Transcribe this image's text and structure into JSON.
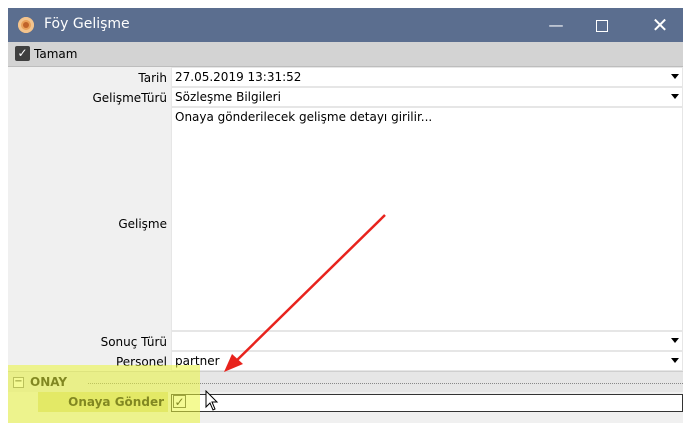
{
  "window": {
    "title": "Föy Gelişme",
    "controls": {
      "minimize_icon": "minimize-icon",
      "maximize_icon": "maximize-icon",
      "close_icon": "close-icon"
    }
  },
  "toolbar": {
    "ok_label": "Tamam"
  },
  "form": {
    "date_label": "Tarih",
    "date_value": "27.05.2019 13:31:52",
    "type_label": "GelişmeTürü",
    "type_value": "Sözleşme Bilgileri",
    "detail_label": "Gelişme",
    "detail_placeholder": "Onaya gönderilecek gelişme detayı girilir...",
    "result_label": "Sonuç Türü",
    "result_value": "",
    "staff_label": "Personel",
    "staff_value": "partner"
  },
  "approval_section": {
    "title": "ONAY",
    "send_label": "Onaya Gönder",
    "send_checked": true
  },
  "colors": {
    "titlebar": "#5b6e8f",
    "highlight": "#ebf53c",
    "annotation_arrow": "#e8231d"
  }
}
